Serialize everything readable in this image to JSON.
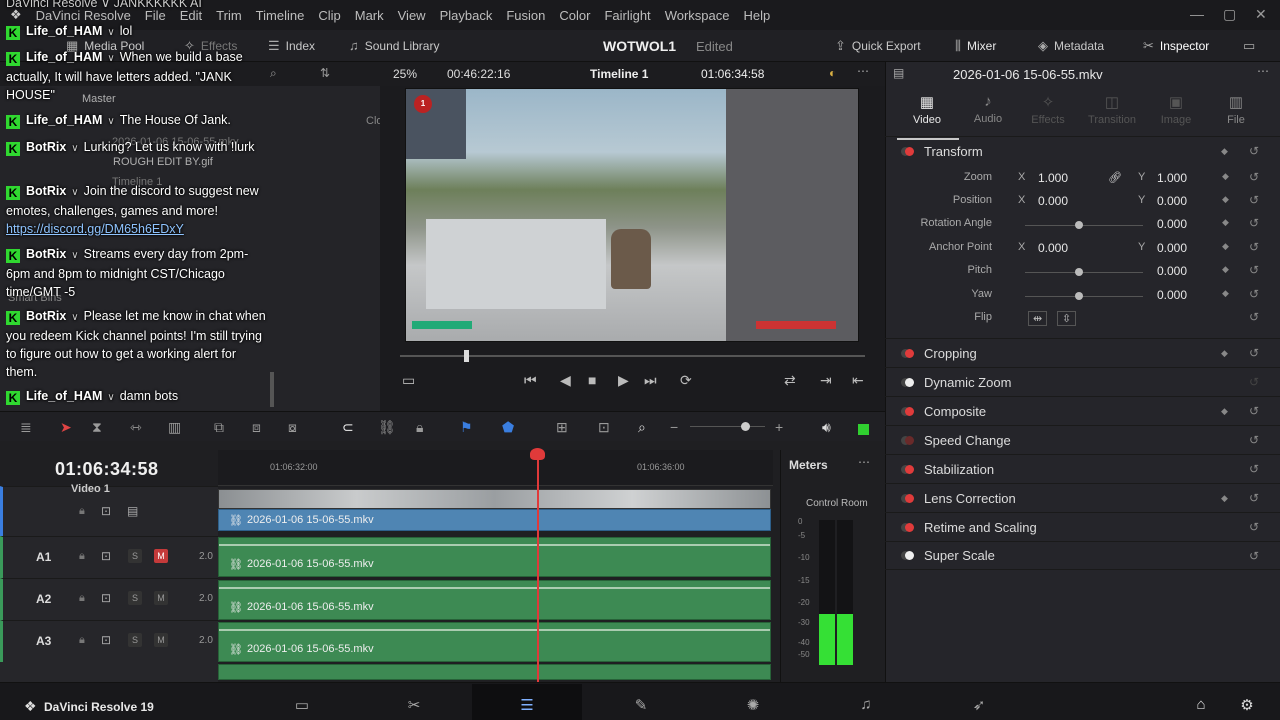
{
  "menu": {
    "app_name": "DaVinci Resolve",
    "items": [
      "File",
      "Edit",
      "Trim",
      "Timeline",
      "Clip",
      "Mark",
      "View",
      "Playback",
      "Fusion",
      "Color",
      "Fairlight",
      "Workspace",
      "Help"
    ]
  },
  "toolbar": {
    "media_pool": "Media Pool",
    "effects": "Effects",
    "index": "Index",
    "sound_library": "Sound Library",
    "project_name": "WOTWOL1",
    "project_status": "Edited",
    "quick_export": "Quick Export",
    "mixer": "Mixer",
    "metadata": "Metadata",
    "inspector": "Inspector"
  },
  "viewer": {
    "zoom": "25%",
    "source_tc": "00:46:22:16",
    "timeline_name": "Timeline 1",
    "record_tc": "01:06:34:58"
  },
  "left_panel": {
    "master": "Master",
    "bin_item": "2026-01-06 15-06-55.mkv",
    "gif_item": "ROUGH EDIT BY.gif",
    "timeline_item": "Timeline 1",
    "smart_bins": "Smart Bins",
    "col": "Clo"
  },
  "inspector": {
    "clip_name": "2026-01-06 15-06-55.mkv",
    "tabs": [
      {
        "label": "Video",
        "state": "active"
      },
      {
        "label": "Audio",
        "state": "normal"
      },
      {
        "label": "Effects",
        "state": "dim"
      },
      {
        "label": "Transition",
        "state": "dim"
      },
      {
        "label": "Image",
        "state": "dim"
      },
      {
        "label": "File",
        "state": "normal"
      }
    ],
    "transform": {
      "title": "Transform",
      "zoom": {
        "label": "Zoom",
        "x": "1.000",
        "y": "1.000"
      },
      "position": {
        "label": "Position",
        "x": "0.000",
        "y": "0.000"
      },
      "rotation": {
        "label": "Rotation Angle",
        "value": "0.000"
      },
      "anchor": {
        "label": "Anchor Point",
        "x": "0.000",
        "y": "0.000"
      },
      "pitch": {
        "label": "Pitch",
        "value": "0.000"
      },
      "yaw": {
        "label": "Yaw",
        "value": "0.000"
      },
      "flip": {
        "label": "Flip"
      },
      "x_axis": "X",
      "y_axis": "Y"
    },
    "sections": [
      "Cropping",
      "Dynamic Zoom",
      "Composite",
      "Speed Change",
      "Stabilization",
      "Lens Correction",
      "Retime and Scaling",
      "Super Scale"
    ]
  },
  "timeline": {
    "timecode": "01:06:34:58",
    "ruler": [
      "01:06:32:00",
      "01:06:36:00"
    ],
    "video_track": "Video 1",
    "clip_name": "2026-01-06 15-06-55.mkv",
    "audio_tracks": [
      {
        "name": "A1",
        "level": "2.0"
      },
      {
        "name": "A2",
        "level": "2.0"
      },
      {
        "name": "A3",
        "level": "2.0"
      }
    ],
    "solo": "S",
    "mute": "M"
  },
  "meters": {
    "title": "Meters",
    "control_room": "Control Room",
    "scale": [
      "0",
      "-5",
      "-10",
      "-15",
      "-20",
      "-30",
      "-40",
      "-50"
    ],
    "level_left": 0.35,
    "level_right": 0.35
  },
  "footer": {
    "app": "DaVinci Resolve 19"
  },
  "chat": [
    {
      "user": "",
      "text": "DaVinci Resolve  ∨  JANKKKKKK AI"
    },
    {
      "user": "Life_of_HAM",
      "text": "lol"
    },
    {
      "user": "Life_of_HAM",
      "text": "When we build a base actually, It will have letters added. \"JANK HOUSE\""
    },
    {
      "user": "Life_of_HAM",
      "text": "The House Of Jank."
    },
    {
      "user": "BotRix",
      "text": "Lurking? Let us know with !lurk"
    },
    {
      "user": "BotRix",
      "text": "Join the discord to suggest new emotes, challenges, games and more! ",
      "link": "https://discord.gg/DM65h6EDxY"
    },
    {
      "user": "BotRix",
      "text": "Streams every day from 2pm-6pm and 8pm to midnight CST/Chicago time/GMT -5"
    },
    {
      "user": "BotRix",
      "text": "Please let me know in chat when you redeem Kick channel points! I'm still trying to figure out how to get a working alert for them."
    },
    {
      "user": "Life_of_HAM",
      "text": "damn bots"
    }
  ]
}
